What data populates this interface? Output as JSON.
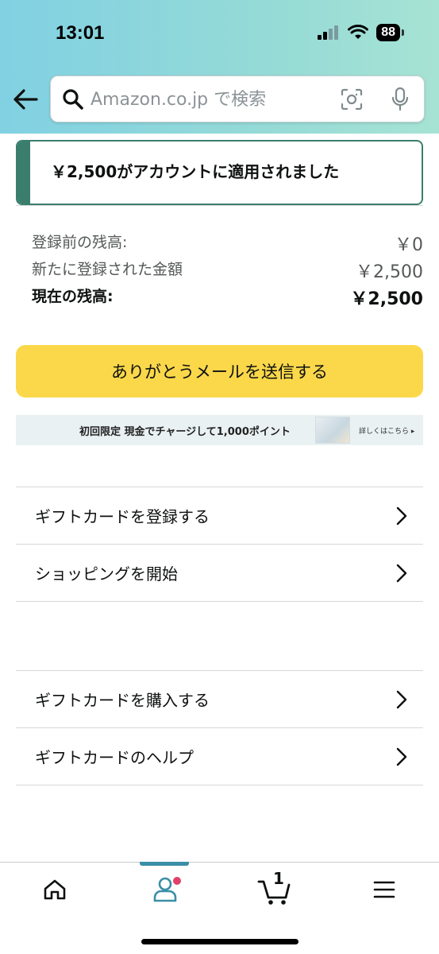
{
  "status_bar": {
    "time": "13:01",
    "battery": "88"
  },
  "search": {
    "placeholder": "Amazon.co.jp で検索"
  },
  "alert": {
    "message": "￥2,500がアカウントに適用されました"
  },
  "balance": {
    "rows": [
      {
        "label": "登録前の残高:",
        "value": "￥0"
      },
      {
        "label": "新たに登録された金額",
        "value": "￥2,500"
      },
      {
        "label": "現在の残高:",
        "value": "￥2,500"
      }
    ]
  },
  "thanks_button": {
    "label": "ありがとうメールを送信する"
  },
  "banner": {
    "text": "初回限定  現金でチャージして1,000ポイント",
    "more": "詳しくはこちら ▸"
  },
  "menu_group_1": [
    {
      "label": "ギフトカードを登録する"
    },
    {
      "label": "ショッピングを開始"
    }
  ],
  "menu_group_2": [
    {
      "label": "ギフトカードを購入する"
    },
    {
      "label": "ギフトカードのヘルプ"
    }
  ],
  "bottom_nav": {
    "items": [
      {
        "icon": "home-icon"
      },
      {
        "icon": "account-icon"
      },
      {
        "icon": "cart-icon",
        "count": "1"
      },
      {
        "icon": "menu-icon"
      }
    ]
  },
  "colors": {
    "accent": "#3b7e6d",
    "button": "#fbd84a",
    "notification_dot": "#e0406a"
  }
}
